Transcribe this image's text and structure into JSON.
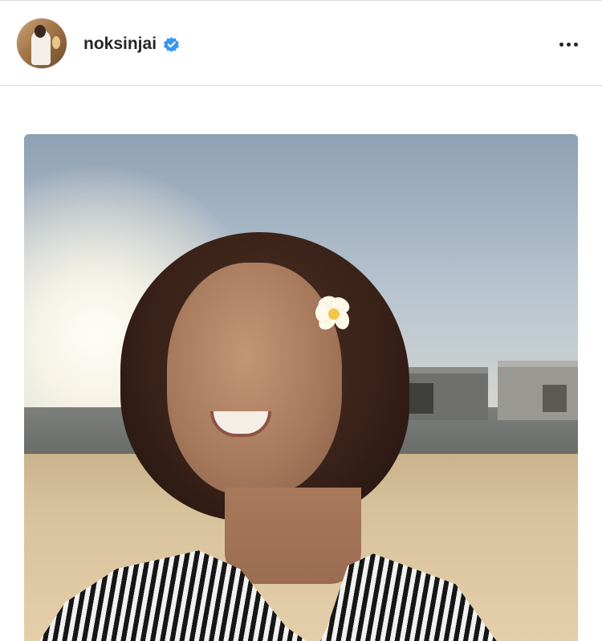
{
  "post_header": {
    "username": "noksinjai",
    "verified": true,
    "verified_badge_color": "#3897f0",
    "avatar_icon": "profile-avatar",
    "more_icon": "more-options-icon"
  },
  "photo": {
    "icon": "post-photo"
  },
  "colors": {
    "text": "#262626",
    "divider": "#dbdbdb",
    "background": "#ffffff"
  }
}
